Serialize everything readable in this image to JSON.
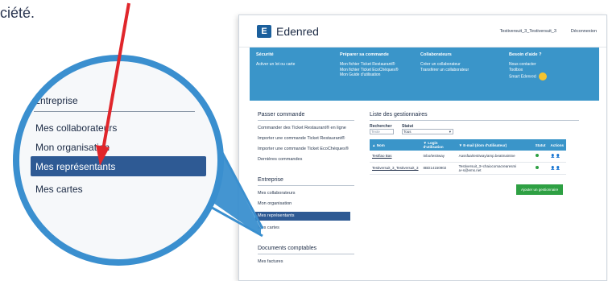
{
  "caption": "ciété.",
  "app": {
    "brand": "Edenred",
    "header_user": "Testiversuit_3_Testiversuit_3",
    "header_logout": "Déconnexion"
  },
  "band": {
    "col1": {
      "title": "Sécurité",
      "lines": [
        "Activer un lot ou carte"
      ]
    },
    "col2": {
      "title": "Préparer sa commande",
      "lines": [
        "Mon fichier Ticket Restaurant®",
        "Mon fichier Ticket EcoChèques®",
        "Mon Guide d'utilisation"
      ]
    },
    "col3": {
      "title": "Collaborateurs",
      "lines": [
        "Créer un collaborateur",
        "Transférer un collaborateur"
      ]
    },
    "col4": {
      "title": "Besoin d'aide ?",
      "lines": [
        "Nous contacter",
        "Toolbox",
        "Smart Edenred"
      ]
    }
  },
  "sidebar": {
    "section1_title": "Passer commande",
    "section1_items": [
      "Commander des Ticket Restaurant® en ligne",
      "Importer une commande Ticket Restaurant®",
      "Importer une commande Ticket EcoChèques®",
      "Dernières commandes"
    ],
    "section2_title": "Entreprise",
    "section2_items": [
      "Mes collaborateurs",
      "Mon organisation",
      "Mes représentants",
      "Mes cartes"
    ],
    "section3_title": "Documents comptables",
    "section3_items": [
      "Mes factures"
    ]
  },
  "main": {
    "title": "Liste des gestionnaires",
    "filter_search_label": "Rechercher",
    "filter_search_placeholder": "Texte",
    "filter_status_label": "Statut",
    "filter_status_value": "Tous",
    "columns": [
      "▲ Nom",
      "▼ Login d'utilisation",
      "▼ E-mail (dom d'utilisateur)",
      "Statut",
      "Actions"
    ],
    "rows": [
      {
        "name": "Testfiao Bas",
        "login": "tnbo/testIway",
        "email": "Aassfaa/testIway/amp.beatmaintne"
      },
      {
        "name": "Testiversuit_3_Testiversuit_3",
        "login": "8BD14150902",
        "email": "Testiversuit_3+chaiocomacrearesmi a+s@ems.net"
      }
    ],
    "add_button": "Ajouter un gestionnaire"
  },
  "zoom": {
    "heading": "Entreprise",
    "items": [
      "Mes collaborateurs",
      "Mon organisation",
      "Mes représentants",
      "Mes cartes"
    ],
    "active_index": 2
  },
  "colors": {
    "accent": "#3a95c9",
    "active": "#2e5a94",
    "arrow": "#e0262b",
    "green": "#2ea043"
  }
}
